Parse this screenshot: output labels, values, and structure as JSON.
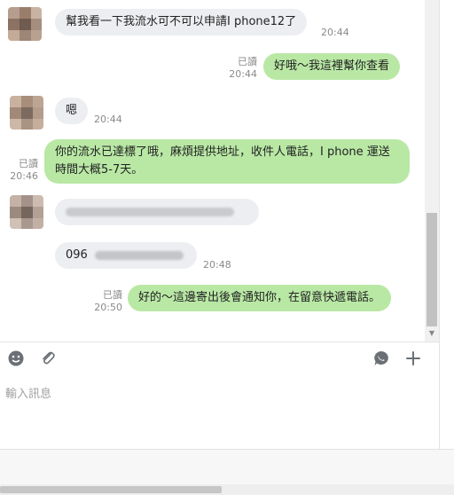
{
  "messages": [
    {
      "side": "in",
      "text": "幫我看一下我流水可不可以申請I phone12了",
      "time": "20:44"
    },
    {
      "side": "out",
      "text": "好哦～我這裡幫你查看",
      "read": "已讀",
      "time": "20:44"
    },
    {
      "side": "in",
      "text": "嗯",
      "time": "20:44"
    },
    {
      "side": "out",
      "text": "你的流水已達標了哦，麻煩提供地址，收件人電話，I phone 運送時間大概5-7天。",
      "read": "已讀",
      "time": "20:46"
    },
    {
      "side": "in",
      "text": "",
      "time": ""
    },
    {
      "side": "in",
      "text": "096",
      "time": "20:48"
    },
    {
      "side": "out",
      "text": "好的～這邊寄出後會通知你，在留意快遞電話。",
      "read": "已讀",
      "time": "20:50"
    }
  ],
  "composer": {
    "placeholder": "輸入訊息"
  },
  "icons": {
    "emoji": "emoji-icon",
    "attach": "paperclip-icon",
    "voice": "chat-bubble-icon",
    "add": "plus-icon"
  },
  "colors": {
    "outgoing": "#b9e8a5",
    "incoming": "#eceef1",
    "meta": "#8a8a8a"
  }
}
